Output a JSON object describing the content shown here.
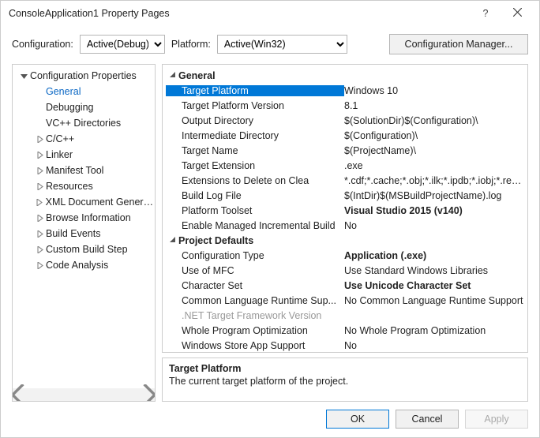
{
  "window": {
    "title": "ConsoleApplication1 Property Pages"
  },
  "top": {
    "config_label": "Configuration:",
    "config_value": "Active(Debug)",
    "platform_label": "Platform:",
    "platform_value": "Active(Win32)",
    "config_manager": "Configuration Manager..."
  },
  "tree": {
    "root": "Configuration Properties",
    "items": [
      {
        "label": "General",
        "selected": true,
        "leaf": true
      },
      {
        "label": "Debugging",
        "leaf": true
      },
      {
        "label": "VC++ Directories",
        "leaf": true
      },
      {
        "label": "C/C++",
        "leaf": false
      },
      {
        "label": "Linker",
        "leaf": false
      },
      {
        "label": "Manifest Tool",
        "leaf": false
      },
      {
        "label": "Resources",
        "leaf": false
      },
      {
        "label": "XML Document Genera...",
        "leaf": false
      },
      {
        "label": "Browse Information",
        "leaf": false
      },
      {
        "label": "Build Events",
        "leaf": false
      },
      {
        "label": "Custom Build Step",
        "leaf": false
      },
      {
        "label": "Code Analysis",
        "leaf": false
      }
    ]
  },
  "props": {
    "sections": [
      {
        "title": "General",
        "rows": [
          {
            "name": "Target Platform",
            "value": "Windows 10",
            "selected": true
          },
          {
            "name": "Target Platform Version",
            "value": "8.1"
          },
          {
            "name": "Output Directory",
            "value": "$(SolutionDir)$(Configuration)\\"
          },
          {
            "name": "Intermediate Directory",
            "value": "$(Configuration)\\"
          },
          {
            "name": "Target Name",
            "value": "$(ProjectName)\\"
          },
          {
            "name": "Target Extension",
            "value": ".exe"
          },
          {
            "name": "Extensions to Delete on Clea",
            "value": "*.cdf;*.cache;*.obj;*.ilk;*.ipdb;*.iobj;*.resou..."
          },
          {
            "name": "Build Log File",
            "value": "$(IntDir)$(MSBuildProjectName).log"
          },
          {
            "name": "Platform Toolset",
            "value": "Visual Studio 2015 (v140)",
            "bold": true
          },
          {
            "name": "Enable Managed Incremental Build",
            "value": "No"
          }
        ]
      },
      {
        "title": "Project Defaults",
        "rows": [
          {
            "name": "Configuration Type",
            "value": "Application (.exe)",
            "bold": true
          },
          {
            "name": "Use of MFC",
            "value": "Use Standard Windows Libraries"
          },
          {
            "name": "Character Set",
            "value": "Use Unicode Character Set",
            "bold": true
          },
          {
            "name": "Common Language Runtime Sup...",
            "value": "No Common Language Runtime Support"
          },
          {
            "name": ".NET Target Framework Version",
            "value": "",
            "disabled": true
          },
          {
            "name": "Whole Program Optimization",
            "value": "No Whole Program Optimization"
          },
          {
            "name": "Windows Store App Support",
            "value": "No"
          }
        ]
      }
    ]
  },
  "desc": {
    "title": "Target Platform",
    "text": "The current target platform of the project."
  },
  "buttons": {
    "ok": "OK",
    "cancel": "Cancel",
    "apply": "Apply"
  }
}
